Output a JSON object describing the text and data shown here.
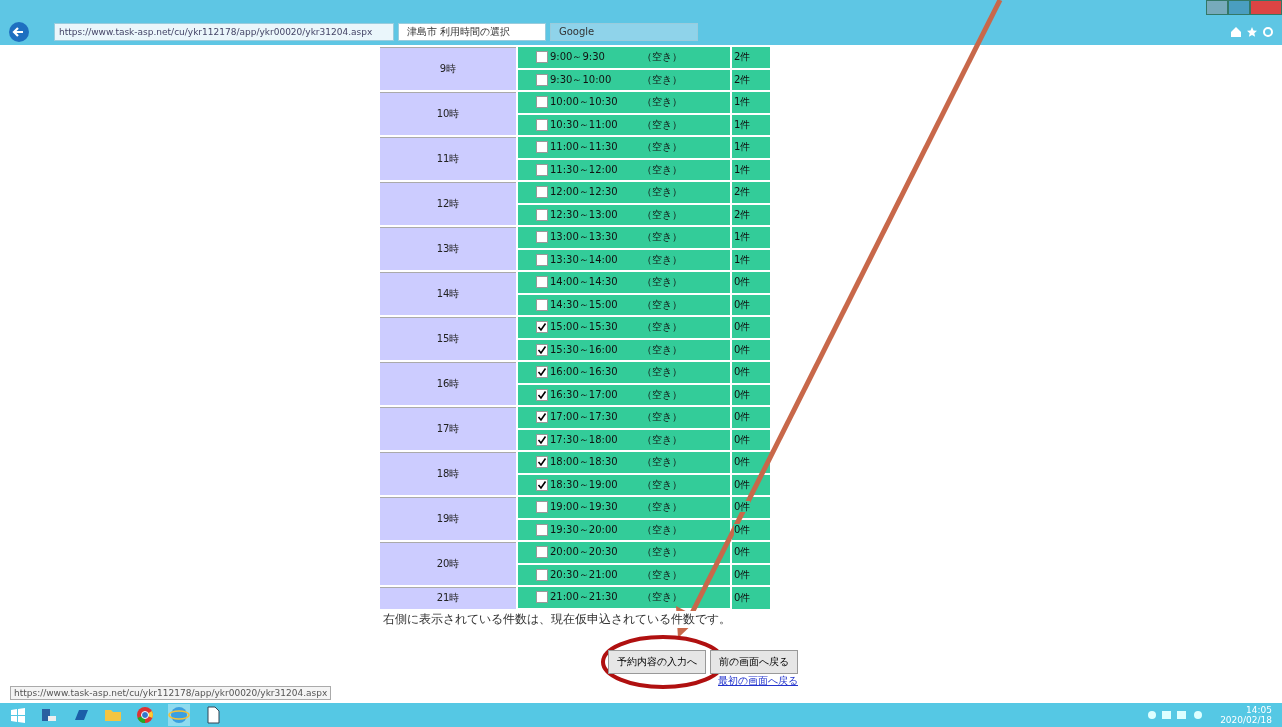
{
  "browser": {
    "address": "https://www.task-asp.net/cu/ykr112178/app/ykr00020/ykr31204.aspx",
    "tabs": [
      {
        "label": "津島市 利用時間の選択",
        "selected": true
      },
      {
        "label": "Google",
        "selected": false
      }
    ]
  },
  "schedule": [
    {
      "hour": "9時",
      "slots": [
        {
          "time": "9:00～9:30",
          "status": "（空き）",
          "count": "2件",
          "checked": false
        },
        {
          "time": "9:30～10:00",
          "status": "（空き）",
          "count": "2件",
          "checked": false
        }
      ]
    },
    {
      "hour": "10時",
      "slots": [
        {
          "time": "10:00～10:30",
          "status": "（空き）",
          "count": "1件",
          "checked": false
        },
        {
          "time": "10:30～11:00",
          "status": "（空き）",
          "count": "1件",
          "checked": false
        }
      ]
    },
    {
      "hour": "11時",
      "slots": [
        {
          "time": "11:00～11:30",
          "status": "（空き）",
          "count": "1件",
          "checked": false
        },
        {
          "time": "11:30～12:00",
          "status": "（空き）",
          "count": "1件",
          "checked": false
        }
      ]
    },
    {
      "hour": "12時",
      "slots": [
        {
          "time": "12:00～12:30",
          "status": "（空き）",
          "count": "2件",
          "checked": false
        },
        {
          "time": "12:30～13:00",
          "status": "（空き）",
          "count": "2件",
          "checked": false
        }
      ]
    },
    {
      "hour": "13時",
      "slots": [
        {
          "time": "13:00～13:30",
          "status": "（空き）",
          "count": "1件",
          "checked": false
        },
        {
          "time": "13:30～14:00",
          "status": "（空き）",
          "count": "1件",
          "checked": false
        }
      ]
    },
    {
      "hour": "14時",
      "slots": [
        {
          "time": "14:00～14:30",
          "status": "（空き）",
          "count": "0件",
          "checked": false
        },
        {
          "time": "14:30～15:00",
          "status": "（空き）",
          "count": "0件",
          "checked": false
        }
      ]
    },
    {
      "hour": "15時",
      "slots": [
        {
          "time": "15:00～15:30",
          "status": "（空き）",
          "count": "0件",
          "checked": true
        },
        {
          "time": "15:30～16:00",
          "status": "（空き）",
          "count": "0件",
          "checked": true
        }
      ]
    },
    {
      "hour": "16時",
      "slots": [
        {
          "time": "16:00～16:30",
          "status": "（空き）",
          "count": "0件",
          "checked": true
        },
        {
          "time": "16:30～17:00",
          "status": "（空き）",
          "count": "0件",
          "checked": true
        }
      ]
    },
    {
      "hour": "17時",
      "slots": [
        {
          "time": "17:00～17:30",
          "status": "（空き）",
          "count": "0件",
          "checked": true
        },
        {
          "time": "17:30～18:00",
          "status": "（空き）",
          "count": "0件",
          "checked": true
        }
      ]
    },
    {
      "hour": "18時",
      "slots": [
        {
          "time": "18:00～18:30",
          "status": "（空き）",
          "count": "0件",
          "checked": true
        },
        {
          "time": "18:30～19:00",
          "status": "（空き）",
          "count": "0件",
          "checked": true
        }
      ]
    },
    {
      "hour": "19時",
      "slots": [
        {
          "time": "19:00～19:30",
          "status": "（空き）",
          "count": "0件",
          "checked": false
        },
        {
          "time": "19:30～20:00",
          "status": "（空き）",
          "count": "0件",
          "checked": false
        }
      ]
    },
    {
      "hour": "20時",
      "slots": [
        {
          "time": "20:00～20:30",
          "status": "（空き）",
          "count": "0件",
          "checked": false
        },
        {
          "time": "20:30～21:00",
          "status": "（空き）",
          "count": "0件",
          "checked": false
        }
      ]
    },
    {
      "hour": "21時",
      "slots": [
        {
          "time": "21:00～21:30",
          "status": "（空き）",
          "count": "0件",
          "checked": false
        }
      ]
    }
  ],
  "note": "右側に表示されている件数は、現在仮申込されている件数です。",
  "buttons": [
    "予約内容の入力へ",
    "前の画面へ戻る"
  ],
  "link": "最初の画面へ戻る",
  "status_url": "https://www.task-asp.net/cu/ykr112178/app/ykr00020/ykr31204.aspx",
  "clock": {
    "time": "14:05",
    "date": "2020/02/18"
  }
}
